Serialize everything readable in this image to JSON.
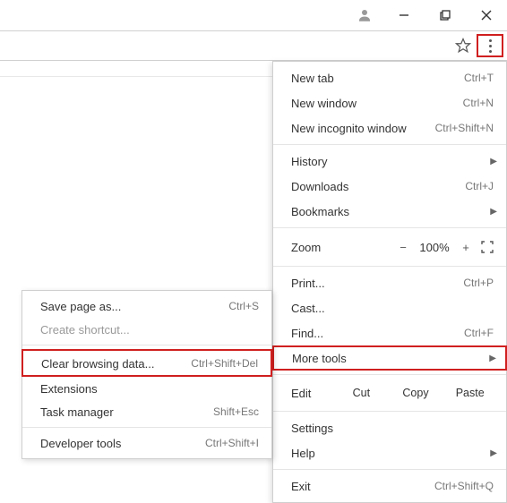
{
  "menu": {
    "new_tab": {
      "label": "New tab",
      "shortcut": "Ctrl+T"
    },
    "new_window": {
      "label": "New window",
      "shortcut": "Ctrl+N"
    },
    "new_incognito": {
      "label": "New incognito window",
      "shortcut": "Ctrl+Shift+N"
    },
    "history": {
      "label": "History"
    },
    "downloads": {
      "label": "Downloads",
      "shortcut": "Ctrl+J"
    },
    "bookmarks": {
      "label": "Bookmarks"
    },
    "zoom": {
      "label": "Zoom",
      "minus": "−",
      "value": "100%",
      "plus": "+"
    },
    "print": {
      "label": "Print...",
      "shortcut": "Ctrl+P"
    },
    "cast": {
      "label": "Cast..."
    },
    "find": {
      "label": "Find...",
      "shortcut": "Ctrl+F"
    },
    "more_tools": {
      "label": "More tools"
    },
    "edit": {
      "label": "Edit",
      "cut": "Cut",
      "copy": "Copy",
      "paste": "Paste"
    },
    "settings": {
      "label": "Settings"
    },
    "help": {
      "label": "Help"
    },
    "exit": {
      "label": "Exit",
      "shortcut": "Ctrl+Shift+Q"
    }
  },
  "submenu": {
    "save_page": {
      "label": "Save page as...",
      "shortcut": "Ctrl+S"
    },
    "create_shortcut": {
      "label": "Create shortcut..."
    },
    "clear_data": {
      "label": "Clear browsing data...",
      "shortcut": "Ctrl+Shift+Del"
    },
    "extensions": {
      "label": "Extensions"
    },
    "task_manager": {
      "label": "Task manager",
      "shortcut": "Shift+Esc"
    },
    "dev_tools": {
      "label": "Developer tools",
      "shortcut": "Ctrl+Shift+I"
    }
  }
}
